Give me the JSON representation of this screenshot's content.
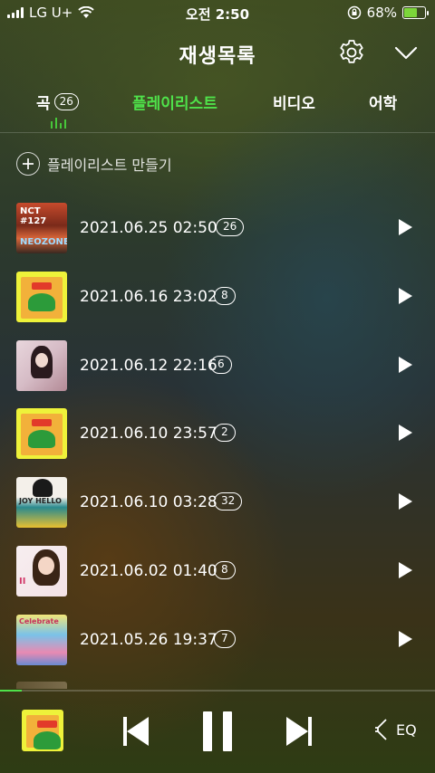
{
  "status_bar": {
    "carrier": "LG U+",
    "time": "오전 2:50",
    "battery_percent": "68%",
    "battery_level": 0.68
  },
  "header": {
    "title": "재생목록",
    "icons": [
      "gear-icon",
      "chevron-down-icon"
    ]
  },
  "tabs": [
    {
      "label": "곡",
      "badge": "26",
      "active": false
    },
    {
      "label": "플레이리스트",
      "active": true
    },
    {
      "label": "비디오",
      "active": false
    },
    {
      "label": "어학",
      "active": false
    }
  ],
  "colors": {
    "accent": "#4fe24a",
    "text": "#ffffff"
  },
  "create_playlist": {
    "label": "플레이리스트 만들기",
    "icon": "plus-circle-icon"
  },
  "playlists": [
    {
      "date": "2021.06.25 02:50",
      "count": "26",
      "cover_text": "NCT #127",
      "cover_text2": "NEOZONE"
    },
    {
      "date": "2021.06.16 23:02",
      "count": "8"
    },
    {
      "date": "2021.06.12 22:16",
      "count": "6"
    },
    {
      "date": "2021.06.10 23:57",
      "count": "2"
    },
    {
      "date": "2021.06.10 03:28",
      "count": "32",
      "cover_text": "JOY HELLO"
    },
    {
      "date": "2021.06.02 01:40",
      "count": "8",
      "cover_text": "II"
    },
    {
      "date": "2021.05.26 19:37",
      "count": "7",
      "cover_text": "Celebrate"
    }
  ],
  "player": {
    "progress": 0.05,
    "eq_label": "EQ",
    "icons": [
      "previous-icon",
      "pause-icon",
      "next-icon",
      "eq-icon"
    ]
  }
}
